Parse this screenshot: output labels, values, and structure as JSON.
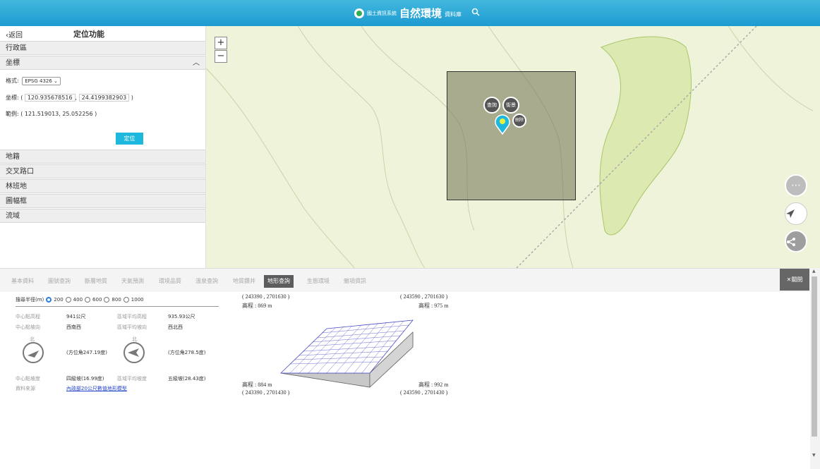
{
  "header": {
    "sys_name": "國土資訊系統",
    "title": "自然環境",
    "sub": "資料庫"
  },
  "sidebar": {
    "back": "返回",
    "page_title": "定位功能",
    "sections": {
      "admin": "行政區",
      "coord": "坐標",
      "land": "地籍",
      "cross": "交叉路口",
      "forest": "林班地",
      "frame": "圖幅框",
      "basin": "流域"
    },
    "format_label": "格式:",
    "format_value": "EPSG 4326",
    "coord_label": "坐標: (",
    "coord_x": "120.935678516",
    "coord_y": "24.4199382903",
    "close_paren": ")",
    "comma": ",",
    "example": "範例: ( 121.519013, 25.052256 )",
    "locate": "定位"
  },
  "map": {
    "zoom_in": "+",
    "zoom_out": "−",
    "query": "查詢",
    "streetview": "街景",
    "delete": "刪除",
    "colors": {
      "square": "#7a7a55",
      "pin": "#1eb8de",
      "fab": "#bdbdbd"
    }
  },
  "tabs": {
    "items": [
      "基本資料",
      "圖號查詢",
      "斷層地質",
      "天氣預測",
      "環境品質",
      "溫泉查詢",
      "地質鑽井",
      "地形查詢",
      "生態環境",
      "雜項資訊"
    ],
    "active": "地形查詢",
    "close": "關閉"
  },
  "info": {
    "radius_label": "搜尋半徑(m)",
    "radius_options": [
      "200",
      "400",
      "600",
      "800",
      "1000"
    ],
    "radius_selected": "200",
    "center_elev_label": "中心點高程",
    "center_elev": "941公尺",
    "area_elev_label": "區域平均高程",
    "area_elev": "935.93公尺",
    "center_aspect_label": "中心點坡向",
    "center_aspect": "西南西",
    "area_aspect_label": "區域平均坡向",
    "area_aspect": "西北西",
    "north": "北",
    "center_angle": "(方位角247.19度)",
    "area_angle": "(方位角278.5度)",
    "center_slope_label": "中心點坡度",
    "center_slope": "四級坡(16.99度)",
    "area_slope_label": "區域平均坡度",
    "area_slope": "五級坡(28.43度)",
    "source_label": "資料來源",
    "source": "內政部20公尺數值地形模型"
  },
  "terrain": {
    "tl_coord": "( 243390 , 2701630 )",
    "tl_elev": "高程 : 869 m",
    "tr_coord": "( 243590 , 2701630 )",
    "tr_elev": "高程 : 975 m",
    "bl_elev": "高程 : 884 m",
    "bl_coord": "( 243390 , 2701430 )",
    "br_elev": "高程 : 992 m",
    "br_coord": "( 243590 , 2701430 )"
  }
}
